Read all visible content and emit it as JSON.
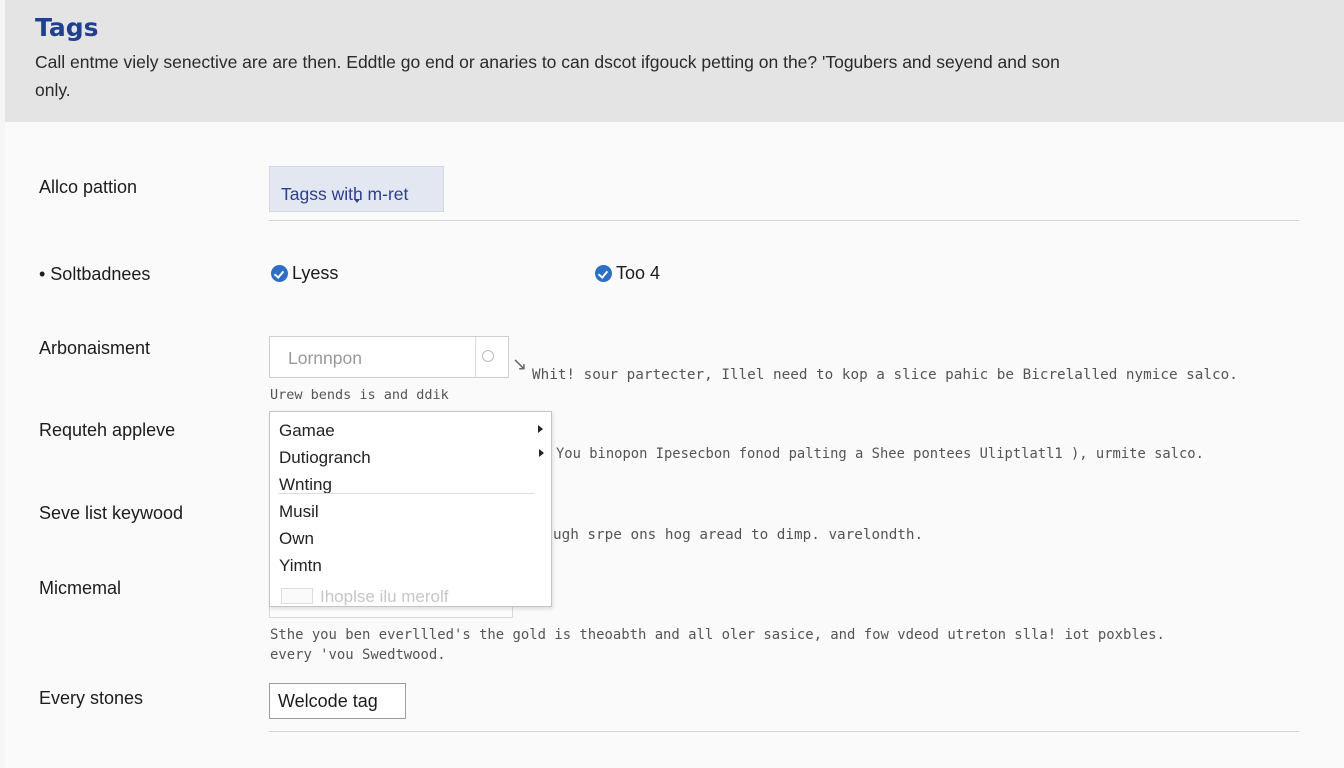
{
  "header": {
    "title": "Tags",
    "description": "Call entme viely senective are are then. Eddtle go end or anaries to can dscot ifgouck petting on the? 'Togubers and seyend and son only."
  },
  "rows": {
    "allo_pattern": {
      "label": "Allco pattion",
      "button_label": "Tagss with m-ret"
    },
    "soltbadnees": {
      "label": "• Soltbadnees",
      "options": [
        {
          "label": "Lyess",
          "checked": true
        },
        {
          "label": "Too 4",
          "checked": true
        }
      ]
    },
    "arbonaisment": {
      "label": "Arbonaisment",
      "placeholder": "Lornnpon",
      "help": "Urew bends is and ddik",
      "side_text": "Whit! sour partecter, Illel need to kop a slice pahic be Bicrelalled nymice salco."
    },
    "requteh_appleve": {
      "label": "Requteh appleve",
      "side_text": "You binopon Ipesecbon fonod palting a Shee pontees Uliptlatl1 ), urmite salco."
    },
    "seve_list": {
      "label": "Seve list keywood",
      "side_text": "ugh srpe ons hog aread to dimp. varelondth."
    },
    "micmemal": {
      "label": "Micmemal",
      "help_line1": "Sthe you ben everllled's the gold is theoabth and all oler sasice, and fow vdeod utreton slla! iot poxbles.",
      "help_line2": "every 'vou Swedtwood."
    },
    "every_stones": {
      "label": "Every stones",
      "value": "Welcode tag"
    }
  },
  "dropdown": {
    "items": [
      {
        "label": "Gamae",
        "submenu": true
      },
      {
        "label": "Dutiogranch",
        "submenu": true
      },
      {
        "label": "Wnting",
        "submenu": false
      },
      {
        "label": "Musil",
        "submenu": false
      },
      {
        "label": "Own",
        "submenu": false
      },
      {
        "label": "Yimtn",
        "submenu": false
      }
    ],
    "faded_item": "Ihoplse ilu merolf"
  },
  "colors": {
    "accent": "#1f3f8f",
    "radio": "#2e6fc4",
    "header_bg": "#e4e4e4"
  }
}
